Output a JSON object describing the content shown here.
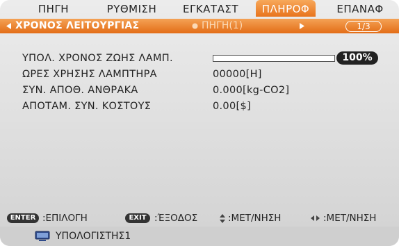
{
  "top_menu": {
    "tabs": [
      {
        "label": "ΠΗΓΗ",
        "active": false
      },
      {
        "label": "ΡΥΘΜΙΣΗ",
        "active": false
      },
      {
        "label": "ΕΓΚΑΤΑΣΤ",
        "active": false
      },
      {
        "label": "ΠΛΗΡΟΦ",
        "active": true
      },
      {
        "label": "ΕΠΑΝΑΦ",
        "active": false
      }
    ]
  },
  "sub_menu": {
    "items": [
      {
        "label": "ΧΡΟΝΟΣ ΛΕΙΤΟΥΡΓΙΑΣ",
        "active": true
      },
      {
        "label": "ΠΗΓΗ(1)",
        "active": false
      }
    ],
    "page_indicator": "1/3"
  },
  "info": {
    "lamp_life": {
      "label": "ΥΠΟΛ. ΧΡΟΝΟΣ ΖΩΗΣ ΛΑΜΠ.",
      "value_text": "100%",
      "value": 100
    },
    "lamp_hours": {
      "label": "ΩΡΕΣ ΧΡΗΣΗΣ ΛΑΜΠΤΗΡΑ",
      "value": "00000[H]"
    },
    "carbon_savings": {
      "label": "ΣΥΝ. ΑΠΟΘ. ΑΝΘΡΑΚΑ",
      "value": "0.000[kg-CO2]"
    },
    "cost_savings": {
      "label": "ΑΠΟΤΑΜ. ΣΥΝ. ΚΟΣΤΟΥΣ",
      "value": "0.00[$]"
    }
  },
  "help_bar": {
    "enter_key": "ENTER",
    "enter_text": ":ΕΠΙΛΟΓΗ",
    "exit_key": "EXIT",
    "exit_text": ":ΈΞΟΔΟΣ",
    "updown_text": ":ΜΕΤ/ΝΗΣΗ",
    "leftright_text": ":ΜΕΤ/ΝΗΣΗ"
  },
  "status": {
    "source_label": "ΥΠΟΛΟΓΙΣΤΗΣ1",
    "icon": "computer-icon"
  },
  "colors": {
    "accent": "#e8741d",
    "background": "#e2e2e2"
  }
}
